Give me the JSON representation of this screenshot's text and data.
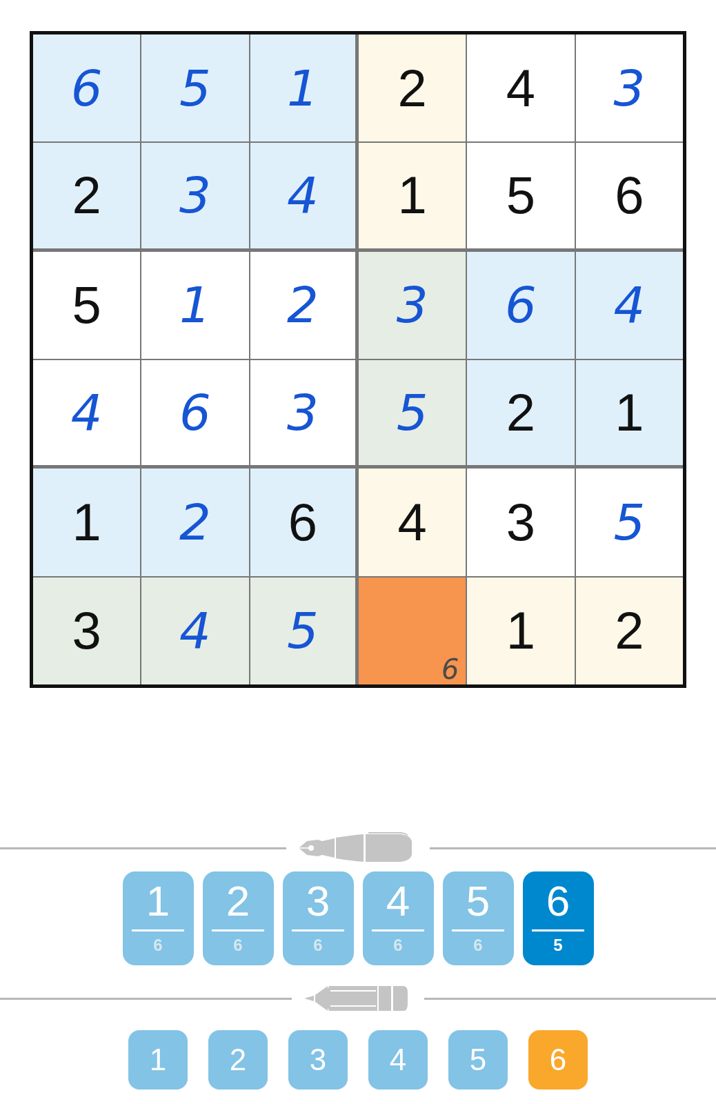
{
  "grid": {
    "rows": [
      [
        {
          "value": "6",
          "kind": "entry",
          "color": "#e0f0fb"
        },
        {
          "value": "5",
          "kind": "entry",
          "color": "#e0f0fb"
        },
        {
          "value": "1",
          "kind": "entry",
          "color": "#e0f0fb"
        },
        {
          "value": "2",
          "kind": "given",
          "color": "#fdf8e8"
        },
        {
          "value": "4",
          "kind": "given",
          "color": "#ffffff"
        },
        {
          "value": "3",
          "kind": "entry",
          "color": "#ffffff"
        }
      ],
      [
        {
          "value": "2",
          "kind": "given",
          "color": "#e0f0fb"
        },
        {
          "value": "3",
          "kind": "entry",
          "color": "#e0f0fb"
        },
        {
          "value": "4",
          "kind": "entry",
          "color": "#e0f0fb"
        },
        {
          "value": "1",
          "kind": "given",
          "color": "#fdf8e8"
        },
        {
          "value": "5",
          "kind": "given",
          "color": "#ffffff"
        },
        {
          "value": "6",
          "kind": "given",
          "color": "#ffffff"
        }
      ],
      [
        {
          "value": "5",
          "kind": "given",
          "color": "#ffffff"
        },
        {
          "value": "1",
          "kind": "entry",
          "color": "#ffffff"
        },
        {
          "value": "2",
          "kind": "entry",
          "color": "#ffffff"
        },
        {
          "value": "3",
          "kind": "entry",
          "color": "#e6ede4"
        },
        {
          "value": "6",
          "kind": "entry",
          "color": "#e0f0fb"
        },
        {
          "value": "4",
          "kind": "entry",
          "color": "#e0f0fb"
        }
      ],
      [
        {
          "value": "4",
          "kind": "entry",
          "color": "#ffffff"
        },
        {
          "value": "6",
          "kind": "entry",
          "color": "#ffffff"
        },
        {
          "value": "3",
          "kind": "entry",
          "color": "#ffffff"
        },
        {
          "value": "5",
          "kind": "entry",
          "color": "#e6ede4"
        },
        {
          "value": "2",
          "kind": "given",
          "color": "#e0f0fb"
        },
        {
          "value": "1",
          "kind": "given",
          "color": "#e0f0fb"
        }
      ],
      [
        {
          "value": "1",
          "kind": "given",
          "color": "#e0f0fb"
        },
        {
          "value": "2",
          "kind": "entry",
          "color": "#e0f0fb"
        },
        {
          "value": "6",
          "kind": "given",
          "color": "#e0f0fb"
        },
        {
          "value": "4",
          "kind": "given",
          "color": "#fdf8e8"
        },
        {
          "value": "3",
          "kind": "given",
          "color": "#ffffff"
        },
        {
          "value": "5",
          "kind": "entry",
          "color": "#ffffff"
        }
      ],
      [
        {
          "value": "3",
          "kind": "given",
          "color": "#e6ede4"
        },
        {
          "value": "4",
          "kind": "entry",
          "color": "#e6ede4"
        },
        {
          "value": "5",
          "kind": "entry",
          "color": "#e6ede4"
        },
        {
          "kind": "empty",
          "note": "6",
          "selected": true
        },
        {
          "value": "1",
          "kind": "given",
          "color": "#fdf8e8"
        },
        {
          "value": "2",
          "kind": "given",
          "color": "#fdf8e8"
        }
      ]
    ]
  },
  "pen_buttons": [
    {
      "digit": "1",
      "count": "6",
      "selected": false
    },
    {
      "digit": "2",
      "count": "6",
      "selected": false
    },
    {
      "digit": "3",
      "count": "6",
      "selected": false
    },
    {
      "digit": "4",
      "count": "6",
      "selected": false
    },
    {
      "digit": "5",
      "count": "6",
      "selected": false
    },
    {
      "digit": "6",
      "count": "5",
      "selected": true
    }
  ],
  "pencil_buttons": [
    {
      "digit": "1",
      "selected": false
    },
    {
      "digit": "2",
      "selected": false
    },
    {
      "digit": "3",
      "selected": false
    },
    {
      "digit": "4",
      "selected": false
    },
    {
      "digit": "5",
      "selected": false
    },
    {
      "digit": "6",
      "selected": true
    }
  ]
}
